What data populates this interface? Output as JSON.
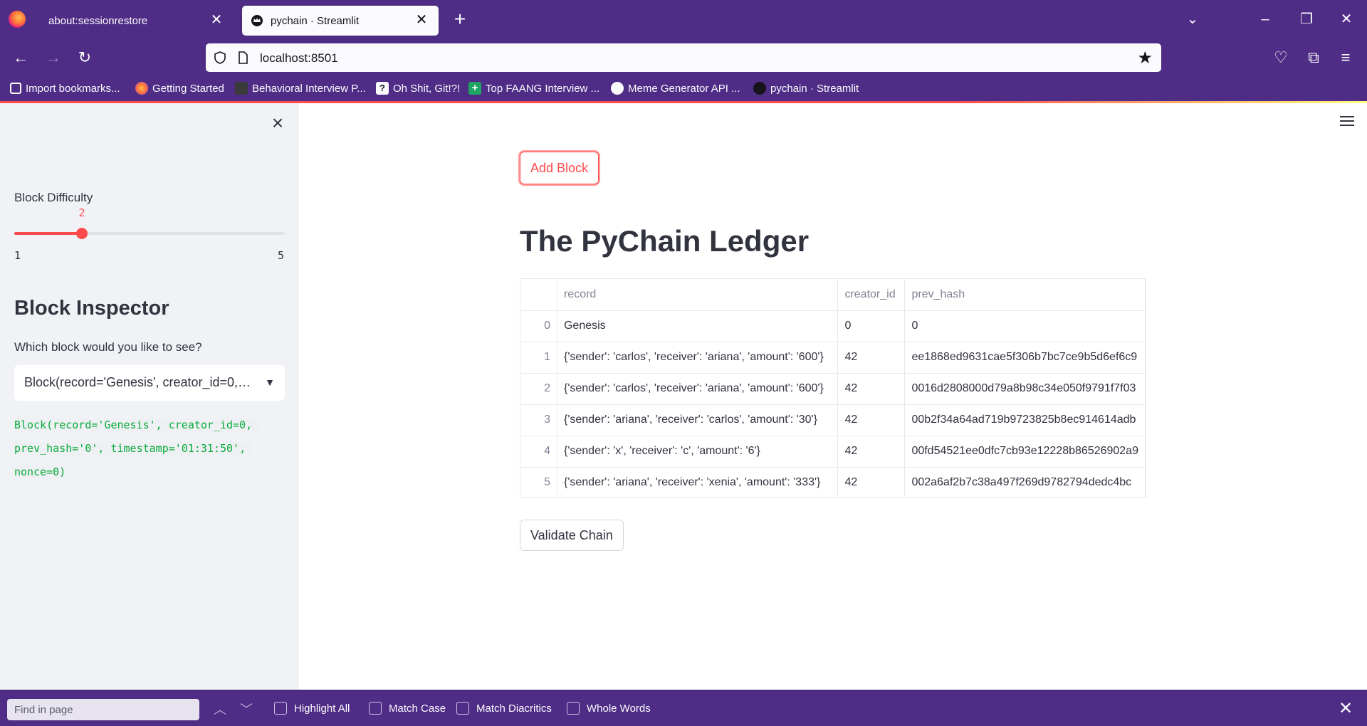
{
  "browser": {
    "tabs": [
      {
        "title": "about:sessionrestore",
        "active": false
      },
      {
        "title": "pychain · Streamlit",
        "active": true
      }
    ],
    "url": "localhost:8501",
    "bookmarks": [
      {
        "label": "Import bookmarks...",
        "icon": "import-icon"
      },
      {
        "label": "Getting Started",
        "icon": "firefox-icon"
      },
      {
        "label": "Behavioral Interview P...",
        "icon": "edx-icon"
      },
      {
        "label": "Oh Shit, Git!?!",
        "icon": "question-icon"
      },
      {
        "label": "Top FAANG Interview ...",
        "icon": "plus-icon"
      },
      {
        "label": "Meme Generator API ...",
        "icon": "meme-icon"
      },
      {
        "label": "pychain · Streamlit",
        "icon": "crown-icon"
      }
    ]
  },
  "sidebar": {
    "slider": {
      "label": "Block Difficulty",
      "value": "2",
      "min": "1",
      "max": "5",
      "fraction": 0.25
    },
    "heading": "Block Inspector",
    "select_label": "Which block would you like to see?",
    "select_value": "Block(record='Genesis', creator_id=0, prev_hash='0', timestamp='01:31:50', nonce=0)",
    "code": "Block(record='Genesis', creator_id=0, prev_hash='0', timestamp='01:31:50', nonce=0)"
  },
  "main": {
    "add_button": "Add Block",
    "title": "The PyChain Ledger",
    "table": {
      "columns": [
        "",
        "record",
        "creator_id",
        "prev_hash"
      ],
      "rows": [
        [
          "0",
          "Genesis",
          "0",
          "0"
        ],
        [
          "1",
          "{'sender': 'carlos', 'receiver': 'ariana', 'amount': '600'}",
          "42",
          "ee1868ed9631cae5f306b7bc7ce9b5d6ef6c9"
        ],
        [
          "2",
          "{'sender': 'carlos', 'receiver': 'ariana', 'amount': '600'}",
          "42",
          "0016d2808000d79a8b98c34e050f9791f7f03"
        ],
        [
          "3",
          "{'sender': 'ariana', 'receiver': 'carlos', 'amount': '30'}",
          "42",
          "00b2f34a64ad719b9723825b8ec914614adb"
        ],
        [
          "4",
          "{'sender': 'x', 'receiver': 'c', 'amount': '6'}",
          "42",
          "00fd54521ee0dfc7cb93e12228b86526902a9"
        ],
        [
          "5",
          "{'sender': 'ariana', 'receiver': 'xenia', 'amount': '333'}",
          "42",
          "002a6af2b7c38a497f269d9782794dedc4bc"
        ]
      ]
    },
    "validate_button": "Validate Chain"
  },
  "findbar": {
    "placeholder": "Find in page",
    "options": [
      "Highlight All",
      "Match Case",
      "Match Diacritics",
      "Whole Words"
    ]
  },
  "colors": {
    "chrome": "#4f2d86",
    "accent": "#ff4b4b",
    "sidebar_bg": "#f0f2f6",
    "code_green": "#09ab3b"
  }
}
